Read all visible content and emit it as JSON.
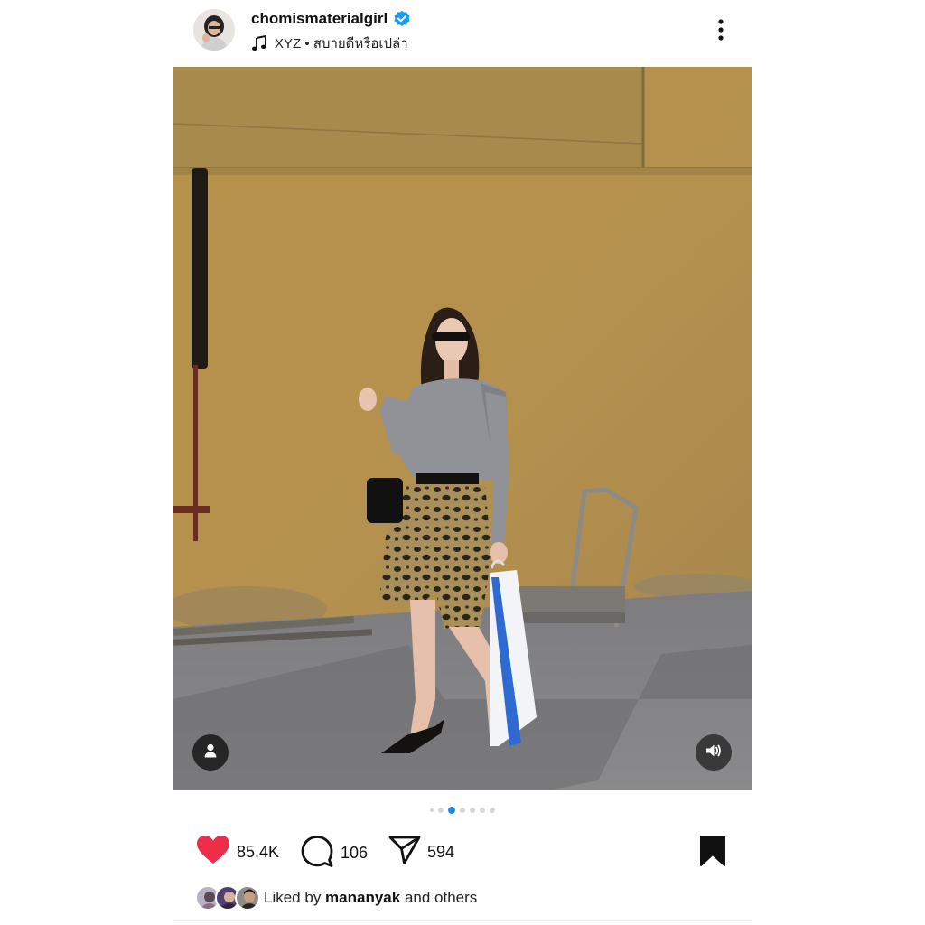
{
  "header": {
    "username": "chomismaterialgirl",
    "verified": true,
    "music_artist": "XYZ",
    "music_separator": " • ",
    "music_title": "สบายดีหรือเปล่า"
  },
  "media": {
    "carousel": {
      "total": 7,
      "active_index": 2
    }
  },
  "actions": {
    "likes": "85.4K",
    "comments": "106",
    "shares": "594"
  },
  "liked_by": {
    "prefix": "Liked by ",
    "user": "mananyak",
    "suffix": " and others"
  },
  "colors": {
    "like": "#ee2d4a",
    "verified": "#1d9bf0",
    "active_dot": "#1d8cf0"
  },
  "icons": [
    "verified-badge-icon",
    "music-note-icon",
    "more-options-icon",
    "person-tag-icon",
    "volume-icon",
    "heart-icon",
    "comment-icon",
    "send-icon",
    "bookmark-icon"
  ]
}
